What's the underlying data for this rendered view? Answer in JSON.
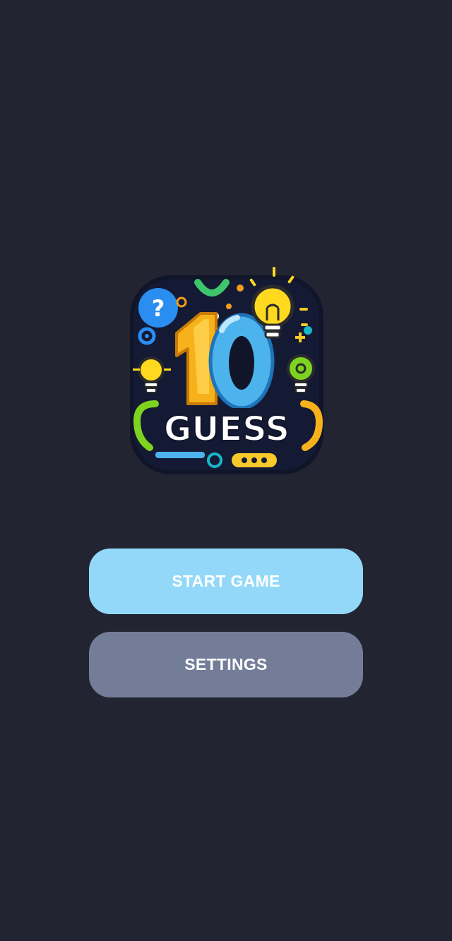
{
  "app": {
    "logo_text_number": "10",
    "logo_text_word": "GUESS"
  },
  "menu": {
    "start_label": "START GAME",
    "settings_label": "SETTINGS"
  },
  "colors": {
    "background": "#222531",
    "start_button": "#93d8f8",
    "settings_button": "#747d98",
    "button_text": "#ffffff"
  }
}
